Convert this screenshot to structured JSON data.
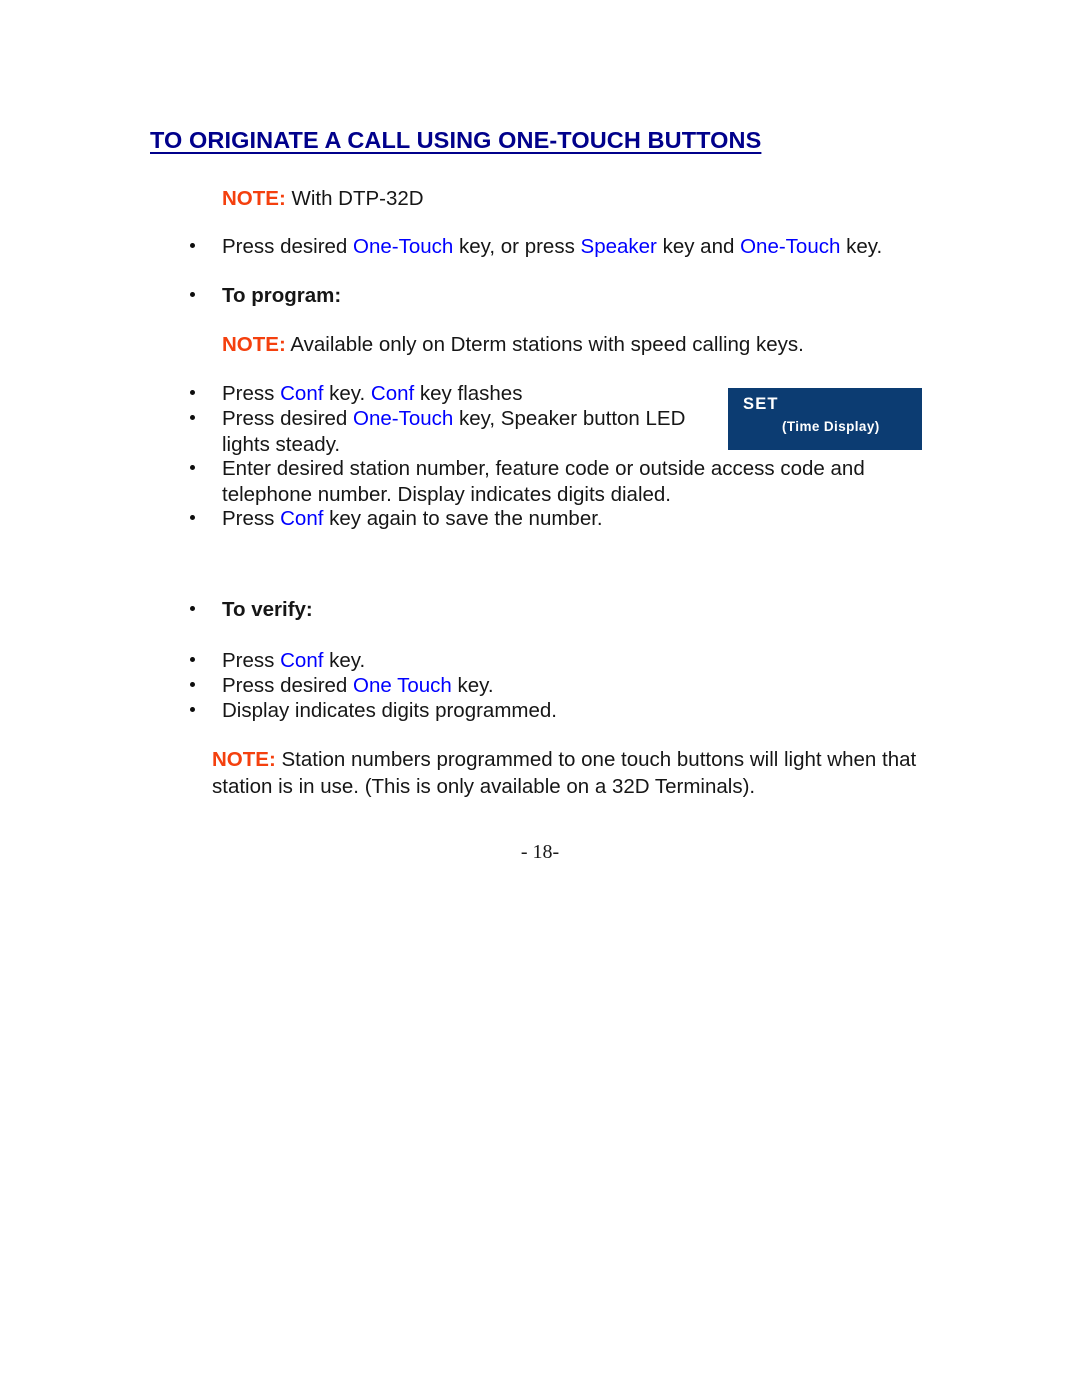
{
  "page": {
    "title": "TO ORIGINATE A CALL USING ONE-TOUCH BUTTONS",
    "page_number": "- 18-",
    "colors": {
      "title": "#00008B",
      "note_label": "#F4400E",
      "keyword": "#0000FF",
      "set_image_background": "#0C3C72",
      "body_text": "#161616"
    }
  },
  "note_top": {
    "label": "NOTE:",
    "text": " With DTP-32D"
  },
  "intro_bullet": {
    "part1": "Press desired ",
    "kw1": "One-Touch",
    "part2": " key, or press ",
    "kw2": "Speaker",
    "part3": " key and ",
    "kw3": "One-Touch",
    "part4": " key."
  },
  "to_program": {
    "heading": "To program:",
    "note": {
      "label": "NOTE:",
      "text": " Available only on Dterm stations with speed calling keys."
    },
    "steps": [
      {
        "part1": "Press ",
        "kw1": "Conf",
        "part2": " key.  ",
        "kw2": "Conf",
        "part3": " key flashes"
      },
      {
        "part1": "Press desired ",
        "kw1": "One-Touch",
        "part2": " key, Speaker button LED lights steady."
      },
      {
        "part1": "Enter desired station number, feature code or outside access code and telephone number.  Display indicates digits dialed."
      },
      {
        "part1": "Press ",
        "kw1": "Conf",
        "part2": " key again to save the number."
      }
    ]
  },
  "set_image": {
    "primary_label": "SET",
    "secondary_label": "(Time Display)"
  },
  "to_verify": {
    "heading": "To verify:",
    "steps": [
      {
        "part1": "Press ",
        "kw1": "Conf",
        "part2": " key."
      },
      {
        "part1": "Press desired ",
        "kw1": "One Touch",
        "part2": " key."
      },
      {
        "part1": "Display indicates digits programmed."
      }
    ]
  },
  "note_bottom": {
    "label": "NOTE:",
    "text": " Station numbers programmed to one touch buttons will light when that station is in use. (This is only available on a 32D Terminals)."
  }
}
